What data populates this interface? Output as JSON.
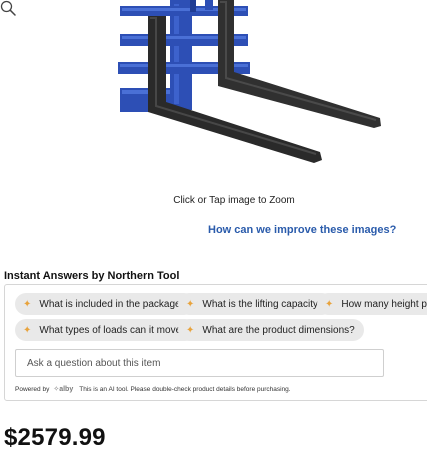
{
  "product": {
    "image_alt": "Pallet forks attachment",
    "zoom_hint": "Click or Tap image to Zoom",
    "improve_link": "How can we improve these images?",
    "price": "$2579.99"
  },
  "instant_answers": {
    "heading": "Instant Answers by Northern Tool",
    "suggestions": [
      "What is included in the package?",
      "What is the lifting capacity?",
      "How many height positions",
      "What types of loads can it move?",
      "What are the product dimensions?"
    ],
    "input_placeholder": "Ask a question about this item",
    "powered_by": "Powered by",
    "brand": "alby",
    "disclaimer": "This is an AI tool. Please double-check product details before purchasing."
  },
  "colors": {
    "frame_blue": "#2d4fb5",
    "fork_dark": "#2c2c2c",
    "link_blue": "#2a5bab",
    "chip_bg": "#e9e9e9",
    "spark": "#e8a33c"
  },
  "icons": [
    "zoom-icon",
    "sparkle-icon",
    "alby-logo"
  ]
}
